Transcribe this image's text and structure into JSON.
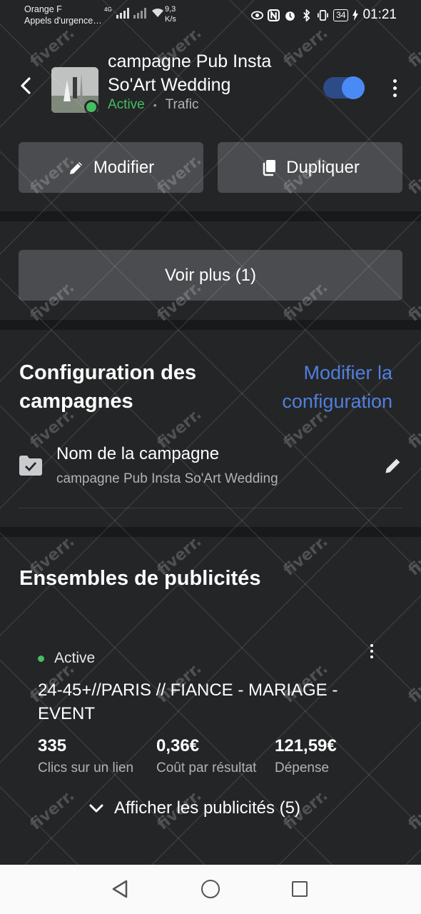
{
  "status_bar": {
    "carrier_line1": "Orange F",
    "carrier_line2": "Appels d'urgence…",
    "network_tag": "4G",
    "speed_value": "9,3",
    "speed_unit": "K/s",
    "battery": "34",
    "time": "01:21"
  },
  "header": {
    "campaign_title": "campagne Pub Insta So'Art Wedding",
    "status": "Active",
    "separator": "•",
    "objective": "Trafic",
    "toggle_on": true,
    "accent_color": "#4a8af4",
    "active_color": "#45bd62"
  },
  "actions": {
    "modify_label": "Modifier",
    "duplicate_label": "Dupliquer",
    "see_more_label": "Voir plus (1)"
  },
  "config": {
    "title": "Configuration des campagnes",
    "edit_link": "Modifier la configuration",
    "row_label": "Nom de la campagne",
    "row_value": "campagne Pub Insta So'Art Wedding"
  },
  "adsets": {
    "title": "Ensembles de publicités",
    "item": {
      "status": "Active",
      "name": "24-45+//PARIS // FIANCE - MARIAGE - EVENT",
      "metrics": [
        {
          "value": "335",
          "label": "Clics sur un lien"
        },
        {
          "value": "0,36€",
          "label": "Coût par résultat"
        },
        {
          "value": "121,59€",
          "label": "Dépense"
        }
      ],
      "show_ads_label": "Afficher les publicités (5)"
    }
  },
  "watermark_text": "fiverr."
}
